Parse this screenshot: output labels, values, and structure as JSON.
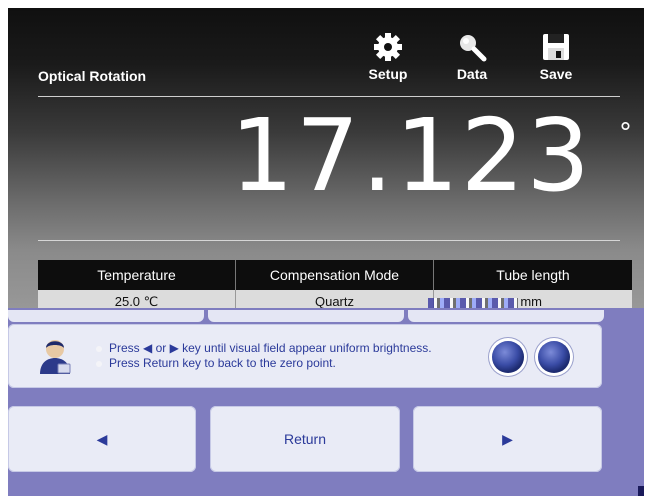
{
  "app": {
    "title": "Optical Rotation"
  },
  "toolbar": {
    "setup_label": "Setup",
    "data_label": "Data",
    "save_label": "Save",
    "icons": [
      "gear-icon",
      "magnifier-icon",
      "floppy-disk-icon"
    ]
  },
  "measurement": {
    "value": "17.123",
    "unit": "°"
  },
  "params": {
    "headers": [
      "Temperature",
      "Compensation Mode",
      "Tube length"
    ],
    "values": [
      "25.0 ℃",
      "Quartz",
      "mm"
    ]
  },
  "instructions": {
    "line1": "Press ◀ or ▶ key until visual field appear uniform brightness.",
    "line2": "Press Return key to back to the zero point."
  },
  "buttons": {
    "left": "◀",
    "return": "Return",
    "right": "▶"
  },
  "colors": {
    "panel": "#7f7dbf",
    "button_bg": "#e9ebf6",
    "accent_text": "#2b3a9a"
  }
}
